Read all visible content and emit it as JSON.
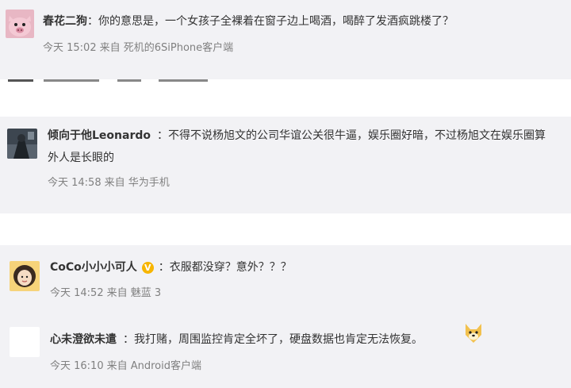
{
  "comments": [
    {
      "username": "春花二狗",
      "text": "你的意思是，一个女孩子全裸着在窗子边上喝酒，喝醉了发酒疯跳楼了？",
      "time": "今天 15:02",
      "source": "来自 死机的6SiPhone客户端"
    },
    {
      "username": "倾向于他Leonardo",
      "text_line1": "不得不说杨旭文的公司华谊公关很牛逼，娱乐圈好暗，不过杨旭文在娱乐圈算",
      "text_line2": "外人是长眼的",
      "time": "今天 14:58",
      "source": "来自 华为手机"
    },
    {
      "username": "CoCo小小小可人",
      "badge": "V",
      "text": "衣服都没穿？意外？？？",
      "time": "今天 14:52",
      "source": "来自 魅蓝 3"
    },
    {
      "username": "心未澄欲未遣",
      "text": "我打赌，周围监控肯定全坏了，硬盘数据也肯定无法恢复。",
      "time": "今天 16:10",
      "source": "来自 Android客户端"
    }
  ],
  "separator": "：",
  "colors": {
    "band_grey": "#f2f2f5",
    "text": "#333333",
    "meta": "#808080",
    "vip": "#f7b500"
  }
}
